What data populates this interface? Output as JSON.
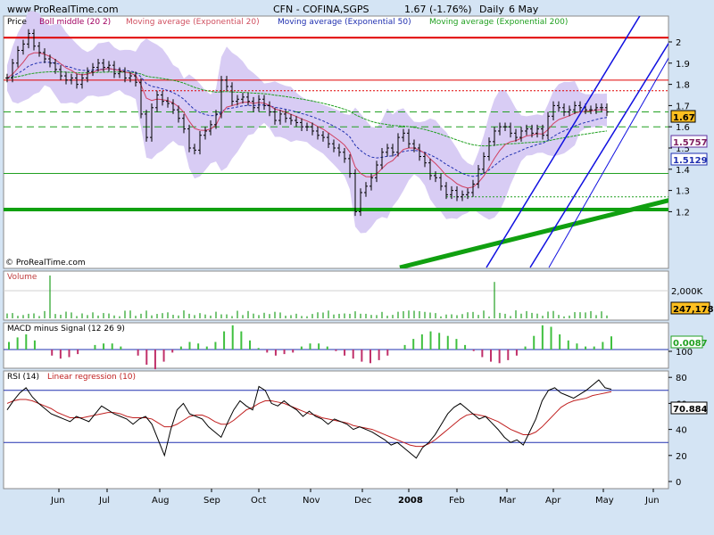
{
  "header": {
    "site": "www.ProRealTime.com",
    "instrument": "CFN - COFINA,SGPS",
    "quote": "1.67 (-1.76%)",
    "period": "Daily",
    "date": "6 May"
  },
  "watermark": "© ProRealTime.com",
  "colors": {
    "band": "#d8ccf4",
    "ema20": "#d04060",
    "ema50": "#2030b0",
    "ema200": "#20a020",
    "channel": "#1010e0",
    "trend": "#10a010",
    "resist": "#e00000",
    "macd": "#40c040",
    "macd_neg": "#c0306a",
    "rsi_reg": "#c02020"
  },
  "chart_data": [
    {
      "type": "line",
      "panel": "Price",
      "title": "CFN - COFINA,SGPS  1.67 (-1.76%)  Daily  6 May",
      "legend": [
        "Price",
        "Boll middle (20 2)",
        "Moving average (Exponential 20)",
        "Moving average (Exponential 50)",
        "Moving average (Exponential 200)"
      ],
      "x_tick_labels": [
        "Jun",
        "Jul",
        "Aug",
        "Sep",
        "Oct",
        "Nov",
        "Dec",
        "2008",
        "Feb",
        "Mar",
        "Apr",
        "May",
        "Jun"
      ],
      "y_tick_labels": [
        "1.2",
        "1.3",
        "1.4",
        "1.5",
        "1.6",
        "1.7",
        "1.8",
        "1.9",
        "2"
      ],
      "ylim": [
        1.17,
        2.06
      ],
      "price_x_index": [
        0,
        3,
        6,
        9,
        12,
        15,
        18,
        21,
        24,
        27,
        30,
        33,
        36,
        39,
        42,
        45,
        48,
        51,
        54,
        57,
        60,
        63,
        66,
        69,
        72,
        75,
        78,
        81,
        84,
        87,
        90,
        93,
        96,
        99,
        102,
        105,
        108,
        111,
        114,
        117,
        120,
        123,
        126,
        129,
        132,
        135,
        138,
        141,
        144,
        147,
        150,
        153,
        156,
        159,
        162,
        165,
        168,
        171,
        174,
        177,
        180,
        183,
        186,
        189,
        192,
        195,
        198,
        201,
        204,
        207,
        210,
        213,
        216,
        219,
        222,
        225,
        228,
        231,
        234,
        237,
        240,
        243,
        246,
        249,
        252,
        255,
        258,
        261,
        264,
        267,
        270,
        273,
        276,
        279,
        282,
        285,
        288,
        291,
        294,
        297,
        300,
        303,
        306,
        309,
        312,
        315,
        318,
        321,
        324,
        327,
        330,
        333,
        336
      ],
      "close": [
        1.83,
        1.9,
        1.96,
        1.99,
        2.04,
        1.98,
        1.95,
        1.92,
        1.9,
        1.87,
        1.84,
        1.82,
        1.83,
        1.8,
        1.83,
        1.86,
        1.88,
        1.9,
        1.88,
        1.89,
        1.85,
        1.86,
        1.83,
        1.84,
        1.81,
        1.66,
        1.55,
        1.69,
        1.75,
        1.72,
        1.71,
        1.68,
        1.64,
        1.59,
        1.5,
        1.49,
        1.56,
        1.58,
        1.61,
        1.66,
        1.82,
        1.79,
        1.72,
        1.73,
        1.74,
        1.72,
        1.69,
        1.73,
        1.7,
        1.67,
        1.63,
        1.66,
        1.64,
        1.63,
        1.62,
        1.6,
        1.6,
        1.58,
        1.56,
        1.55,
        1.52,
        1.5,
        1.48,
        1.45,
        1.38,
        1.2,
        1.29,
        1.32,
        1.36,
        1.42,
        1.48,
        1.5,
        1.48,
        1.55,
        1.57,
        1.52,
        1.5,
        1.46,
        1.43,
        1.37,
        1.36,
        1.32,
        1.28,
        1.3,
        1.27,
        1.28,
        1.29,
        1.33,
        1.4,
        1.46,
        1.53,
        1.58,
        1.6,
        1.6,
        1.57,
        1.55,
        1.58,
        1.59,
        1.57,
        1.59,
        1.56,
        1.65,
        1.7,
        1.69,
        1.67,
        1.68,
        1.7,
        1.69,
        1.68,
        1.68,
        1.69,
        1.69,
        1.67
      ],
      "levels": {
        "resistance_2": 2.02,
        "resistance_1_82": 1.82,
        "dotted_1_77": 1.77,
        "dashed_1_67": 1.67,
        "dashed_1_60": 1.6,
        "support_1_38": 1.38,
        "support_1_21": 1.21,
        "dotted_1_27": 1.27
      },
      "value_labels": [
        "1.67",
        "1.5757",
        "1.5129"
      ]
    },
    {
      "type": "bar",
      "panel": "Volume",
      "title": "Volume",
      "y_tick_labels": [
        "2,000K"
      ],
      "current_value": "247,178",
      "peaks": [
        {
          "x_index": 24,
          "value": 2000000
        },
        {
          "x_index": 272,
          "value": 1700000
        }
      ]
    },
    {
      "type": "bar",
      "panel": "MACD",
      "title": "MACD minus Signal (12 26 9)",
      "current_value": "0.0087",
      "histogram": [
        0.005,
        0.008,
        0.01,
        0.006,
        0.0,
        -0.004,
        -0.006,
        -0.005,
        -0.003,
        0.0,
        0.003,
        0.004,
        0.004,
        0.002,
        0.0,
        -0.004,
        -0.01,
        -0.013,
        -0.008,
        -0.002,
        0.002,
        0.005,
        0.004,
        0.002,
        0.005,
        0.012,
        0.016,
        0.012,
        0.006,
        0.001,
        -0.002,
        -0.004,
        -0.003,
        -0.002,
        0.002,
        0.004,
        0.004,
        0.002,
        -0.001,
        -0.004,
        -0.006,
        -0.008,
        -0.009,
        -0.007,
        -0.004,
        0.0,
        0.003,
        0.007,
        0.01,
        0.012,
        0.011,
        0.009,
        0.007,
        0.003,
        -0.001,
        -0.005,
        -0.008,
        -0.009,
        -0.007,
        -0.004,
        0.002,
        0.009,
        0.016,
        0.015,
        0.01,
        0.006,
        0.004,
        0.002,
        0.002,
        0.005,
        0.0087
      ]
    },
    {
      "type": "line",
      "panel": "RSI",
      "title": "RSI (14)",
      "legend": [
        "RSI (14)",
        "Linear regression (10)"
      ],
      "y_tick_labels": [
        "0",
        "20",
        "40",
        "60",
        "80",
        "100"
      ],
      "ylim": [
        -5,
        105
      ],
      "overbought": 70,
      "oversold": 30,
      "current_value": "70.884",
      "rsi": [
        55,
        62,
        68,
        72,
        65,
        60,
        56,
        52,
        50,
        48,
        46,
        50,
        48,
        46,
        52,
        58,
        55,
        52,
        50,
        48,
        44,
        48,
        50,
        44,
        32,
        20,
        40,
        55,
        60,
        52,
        50,
        48,
        42,
        38,
        34,
        45,
        55,
        62,
        58,
        55,
        73,
        70,
        60,
        58,
        62,
        58,
        55,
        50,
        54,
        50,
        48,
        44,
        48,
        46,
        44,
        40,
        42,
        40,
        38,
        35,
        32,
        28,
        30,
        26,
        22,
        18,
        26,
        30,
        36,
        44,
        52,
        57,
        60,
        56,
        52,
        48,
        50,
        45,
        40,
        34,
        30,
        32,
        28,
        38,
        48,
        62,
        70,
        72,
        68,
        66,
        64,
        67,
        70,
        74,
        78,
        72,
        70.884
      ],
      "regression": [
        60,
        62,
        63,
        63,
        62,
        60,
        58,
        56,
        53,
        51,
        49,
        49,
        49,
        50,
        51,
        52,
        53,
        53,
        52,
        50,
        49,
        49,
        49,
        48,
        45,
        42,
        42,
        44,
        47,
        50,
        51,
        51,
        49,
        46,
        44,
        44,
        47,
        51,
        55,
        57,
        60,
        62,
        62,
        61,
        60,
        58,
        56,
        54,
        52,
        51,
        49,
        48,
        47,
        46,
        45,
        43,
        42,
        41,
        40,
        38,
        36,
        34,
        32,
        30,
        28,
        27,
        27,
        29,
        32,
        36,
        40,
        44,
        48,
        51,
        52,
        51,
        50,
        48,
        46,
        43,
        40,
        38,
        36,
        36,
        38,
        42,
        47,
        52,
        57,
        60,
        62,
        63,
        64,
        66,
        67,
        68,
        69
      ]
    }
  ]
}
